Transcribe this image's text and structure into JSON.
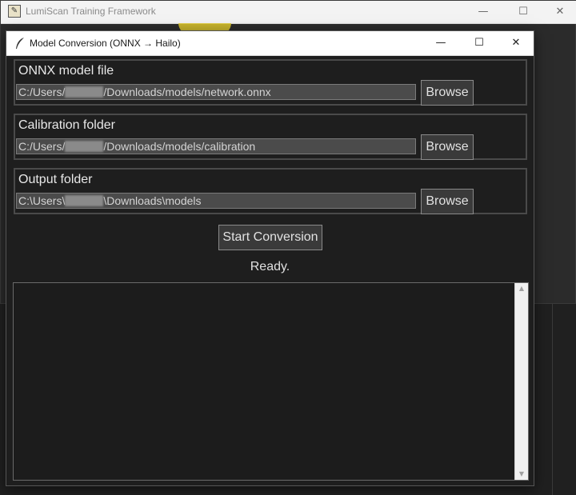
{
  "background_window": {
    "title": "LumiScan Training Framework",
    "controls": {
      "minimize": "—",
      "maximize": "☐",
      "close": "✕"
    }
  },
  "dialog": {
    "title": "Model Conversion (ONNX → Hailo)",
    "controls": {
      "minimize": "—",
      "maximize": "☐",
      "close": "✕"
    },
    "onnx": {
      "label": "ONNX model file",
      "path_prefix": "C:/Users/",
      "path_suffix": "/Downloads/models/network.onnx",
      "browse_label": "Browse"
    },
    "calibration": {
      "label": "Calibration folder",
      "path_prefix": "C:/Users/",
      "path_suffix": "/Downloads/models/calibration",
      "browse_label": "Browse"
    },
    "output": {
      "label": "Output folder",
      "path_prefix": "C:\\Users\\",
      "path_suffix": "\\Downloads\\models",
      "browse_label": "Browse"
    },
    "start_label": "Start Conversion",
    "status": "Ready.",
    "log_text": ""
  },
  "colors": {
    "dialog_bg": "#1e1e1e",
    "input_bg": "#4b4b4b",
    "button_bg": "#3a3a3a",
    "text": "#e8e8e8"
  }
}
